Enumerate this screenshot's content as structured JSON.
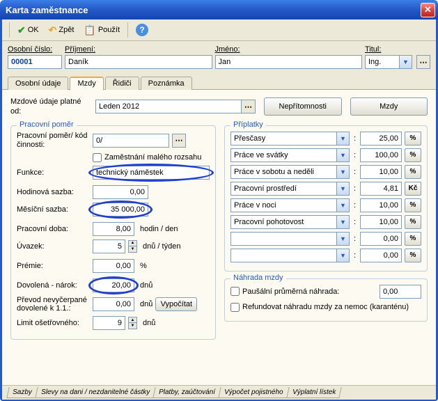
{
  "window": {
    "title": "Karta zaměstnance"
  },
  "toolbar": {
    "ok": "OK",
    "back": "Zpět",
    "apply": "Použít"
  },
  "top": {
    "id_label": "Osobní číslo:",
    "id_value": "00001",
    "surname_label": "Příjmení:",
    "surname_value": "Daník",
    "firstname_label": "Jméno:",
    "firstname_value": "Jan",
    "title_label": "Titul:",
    "title_value": "Ing."
  },
  "tabs": [
    "Osobní údaje",
    "Mzdy",
    "Řidiči",
    "Poznámka"
  ],
  "period": {
    "label": "Mzdové údaje platné od:",
    "value": "Leden 2012",
    "btn_absence": "Nepřítomnosti",
    "btn_wages": "Mzdy"
  },
  "pomer": {
    "group": "Pracovní poměr",
    "code_label": "Pracovní poměr/ kód činnosti:",
    "code_value": "0/",
    "small_label": "Zaměstnání malého rozsahu",
    "funkce_label": "Funkce:",
    "funkce_value": "technický náměstek",
    "hourly_label": "Hodinová sazba:",
    "hourly_value": "0,00",
    "monthly_label": "Měsíční sazba:",
    "monthly_value": "35 000,00",
    "worktime_label": "Pracovní doba:",
    "worktime_value": "8,00",
    "worktime_unit": "hodin / den",
    "uvazek_label": "Úvazek:",
    "uvazek_value": "5",
    "uvazek_unit": "dnů / týden",
    "premie_label": "Prémie:",
    "premie_value": "0,00",
    "premie_unit": "%",
    "vacation_label": "Dovolená - nárok:",
    "vacation_value": "20,00",
    "vacation_unit": "dnů",
    "carry_label": "Převod nevyčerpané dovolené k 1.1.:",
    "carry_value": "0,00",
    "carry_unit": "dnů",
    "calc_btn": "Vypočítat",
    "limit_label": "Limit ošetřovného:",
    "limit_value": "9",
    "limit_unit": "dnů"
  },
  "priplatky": {
    "group": "Příplatky",
    "rows": [
      {
        "name": "Přesčasy",
        "amt": "25,00",
        "unit": "%"
      },
      {
        "name": "Práce ve svátky",
        "amt": "100,00",
        "unit": "%"
      },
      {
        "name": "Práce v sobotu a neděli",
        "amt": "10,00",
        "unit": "%"
      },
      {
        "name": "Pracovní prostředí",
        "amt": "4,81",
        "unit": "Kč"
      },
      {
        "name": "Práce v noci",
        "amt": "10,00",
        "unit": "%"
      },
      {
        "name": "Pracovní pohotovost",
        "amt": "10,00",
        "unit": "%"
      },
      {
        "name": "",
        "amt": "0,00",
        "unit": "%"
      },
      {
        "name": "",
        "amt": "0,00",
        "unit": "%"
      }
    ]
  },
  "nahrada": {
    "group": "Náhrada mzdy",
    "pausal_label": "Paušální průměrná náhrada:",
    "pausal_value": "0,00",
    "refund_label": "Refundovat náhradu mzdy za nemoc (karanténu)"
  },
  "bottom_tabs": [
    "Sazby",
    "Slevy na dani / nezdanitelné částky",
    "Platby, zaúčtování",
    "Výpočet pojistného",
    "Výplatní lístek"
  ]
}
